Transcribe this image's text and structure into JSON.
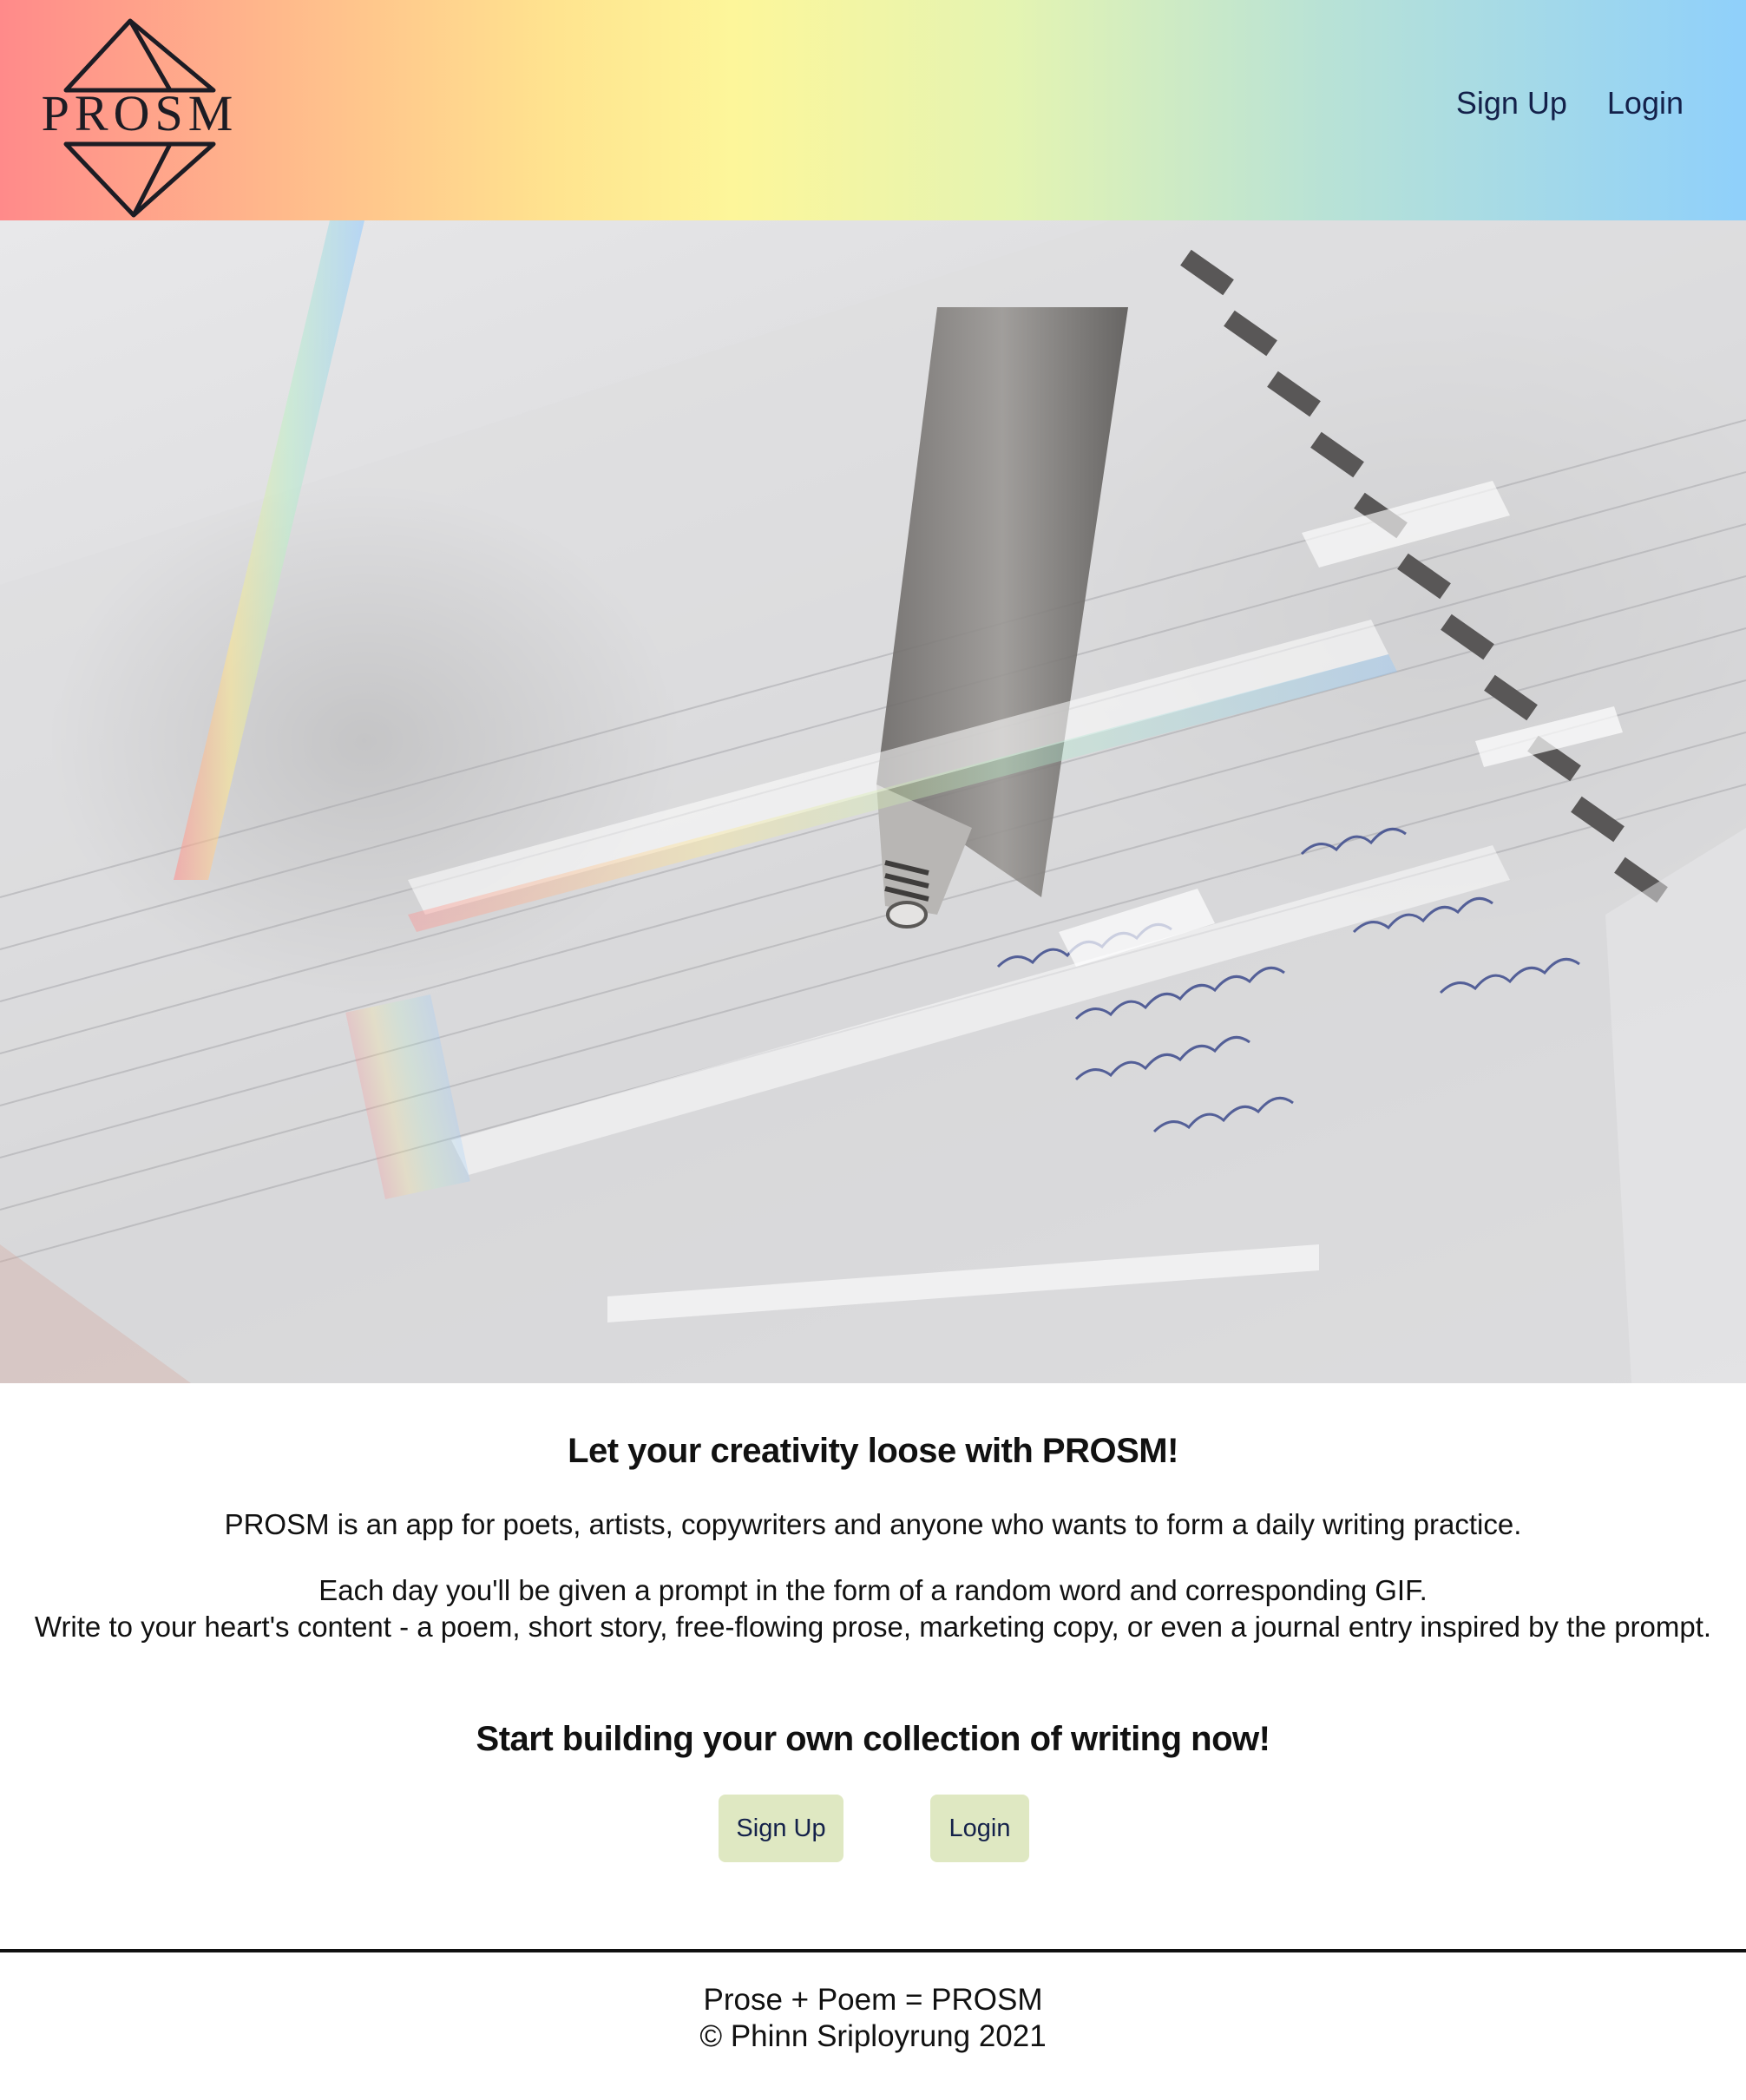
{
  "header": {
    "logo_text": "PROSM",
    "nav": {
      "signup_label": "Sign Up",
      "login_label": "Login"
    },
    "gradient_colors": [
      "#ff8a8a",
      "#ffb98b",
      "#ffe48f",
      "#fdf69a",
      "#e4f4b2",
      "#b8e2d6",
      "#8fd0fb"
    ],
    "link_color": "#14214a"
  },
  "hero": {
    "image_subject": "notebook-with-pen-and-prism-light"
  },
  "main": {
    "headline": "Let your creativity loose with PROSM!",
    "intro": "PROSM is an app for poets, artists, copywriters and anyone who wants to form a daily writing practice.",
    "description_line1": "Each day you'll be given a prompt in the form of a random word and corresponding GIF.",
    "description_line2": "Write to your heart's content - a poem, short story, free-flowing prose, marketing copy, or even a journal entry inspired by the prompt.",
    "cta_heading": "Start building your own collection of writing now!",
    "buttons": {
      "signup_label": "Sign Up",
      "login_label": "Login"
    },
    "button_color": "#dfe8c2"
  },
  "footer": {
    "line1": "Prose + Poem = PROSM",
    "line2": "© Phinn Sriployrung 2021"
  }
}
